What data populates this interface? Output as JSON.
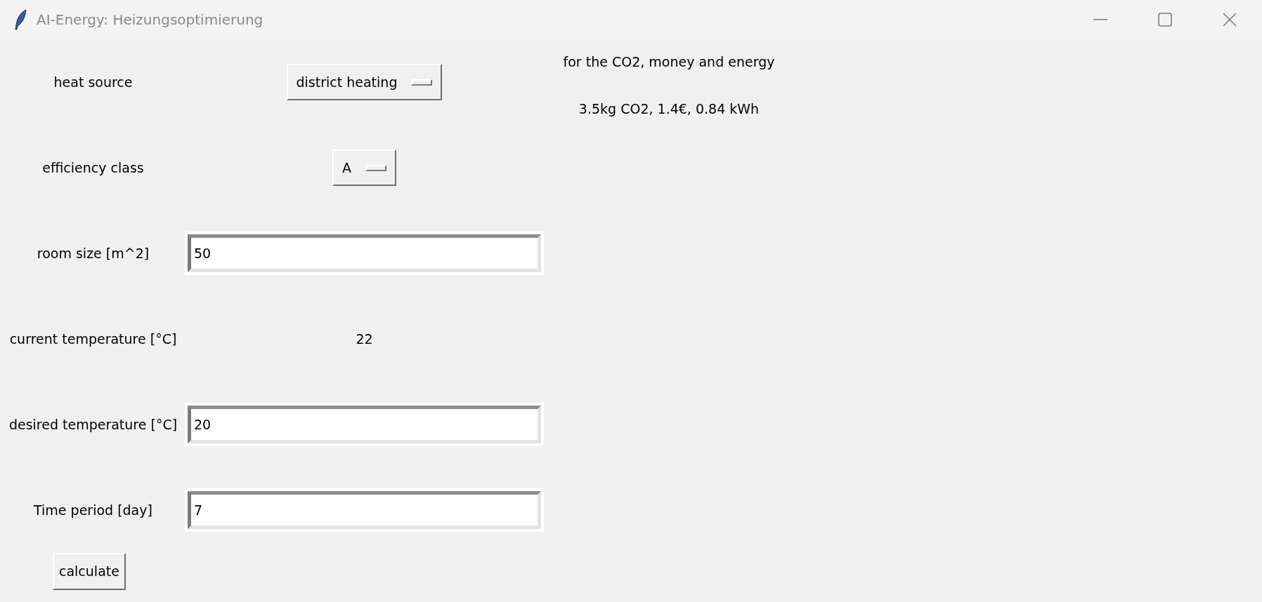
{
  "window": {
    "title": "AI-Energy: Heizungsoptimierung"
  },
  "fields": [
    {
      "kind": "option",
      "label": "heat source",
      "value": "district heating"
    },
    {
      "kind": "option",
      "label": "efficiency class",
      "value": "A"
    },
    {
      "kind": "entry",
      "label": "room size [m^2]",
      "value": "50"
    },
    {
      "kind": "value",
      "label": "current temperature [°C]",
      "value": "22"
    },
    {
      "kind": "entry",
      "label": "desired temperature [°C]",
      "value": "20"
    },
    {
      "kind": "entry",
      "label": "Time period [day]",
      "value": "7"
    }
  ],
  "result": {
    "heading": "for the CO2, money and energy",
    "value": "3.5kg CO2, 1.4€, 0.84 kWh"
  },
  "buttons": [
    "calculate"
  ]
}
